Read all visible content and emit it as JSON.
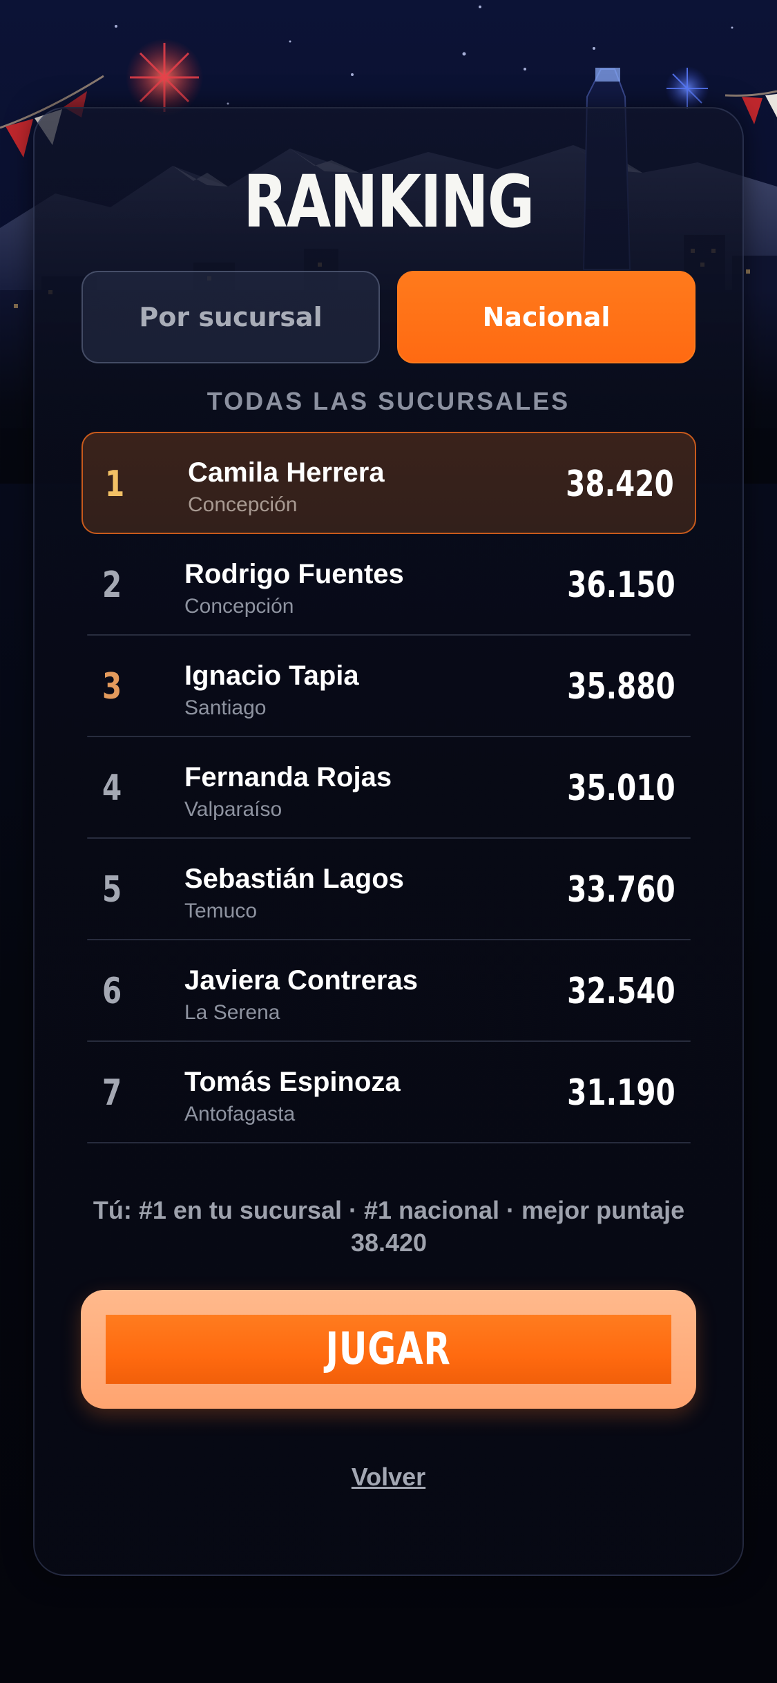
{
  "title": "RANKING",
  "tabs": {
    "sucursal_label": "Por sucursal",
    "nacional_label": "Nacional",
    "active": "nacional"
  },
  "subtitle": "TODAS LAS SUCURSALES",
  "ranking": [
    {
      "position": "1",
      "name": "Camila Herrera",
      "city": "Concepción",
      "score": "38.420"
    },
    {
      "position": "2",
      "name": "Rodrigo Fuentes",
      "city": "Concepción",
      "score": "36.150"
    },
    {
      "position": "3",
      "name": "Ignacio Tapia",
      "city": "Santiago",
      "score": "35.880"
    },
    {
      "position": "4",
      "name": "Fernanda Rojas",
      "city": "Valparaíso",
      "score": "35.010"
    },
    {
      "position": "5",
      "name": "Sebastián Lagos",
      "city": "Temuco",
      "score": "33.760"
    },
    {
      "position": "6",
      "name": "Javiera Contreras",
      "city": "La Serena",
      "score": "32.540"
    },
    {
      "position": "7",
      "name": "Tomás Espinoza",
      "city": "Antofagasta",
      "score": "31.190"
    }
  ],
  "summary": {
    "line1": "Tú: #1 en tu sucursal · #1 nacional · mejor puntaje",
    "line2": "38.420"
  },
  "play_label": "JUGAR",
  "back_label": "Volver",
  "colors": {
    "accent": "#ff6a12",
    "gold": "#f2c065",
    "bronze": "#e39a5c",
    "highlight_border": "#c85a1c"
  }
}
